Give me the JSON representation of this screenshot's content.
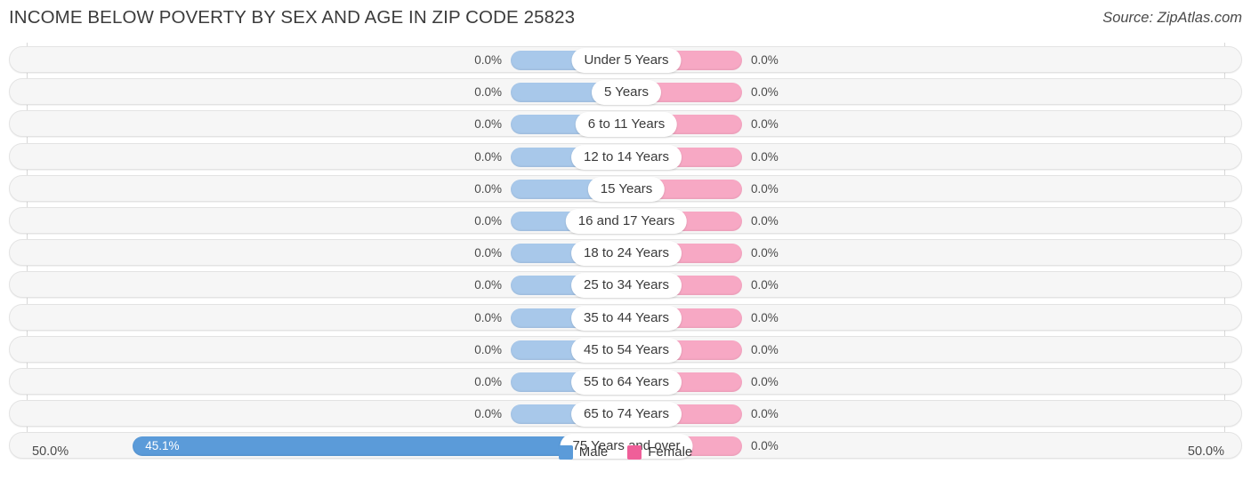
{
  "header": {
    "title": "INCOME BELOW POVERTY BY SEX AND AGE IN ZIP CODE 25823",
    "source": "Source: ZipAtlas.com"
  },
  "axis": {
    "left_label": "50.0%",
    "right_label": "50.0%"
  },
  "legend": {
    "male_label": "Male",
    "female_label": "Female",
    "male_color": "#5b9bd9",
    "female_color": "#ef5f99"
  },
  "colors": {
    "male_bar": "#a8c8ea",
    "male_bar_highlight": "#5b9bd9",
    "female_bar": "#f7a8c4",
    "row_track": "#f6f6f6",
    "gridline": "#d8d8d8"
  },
  "chart_data": {
    "type": "bar",
    "subtype": "diverging-bar",
    "title": "INCOME BELOW POVERTY BY SEX AND AGE IN ZIP CODE 25823",
    "xlabel": "",
    "ylabel": "",
    "xlim": [
      50.0,
      50.0
    ],
    "grid": true,
    "legend_position": "bottom-center",
    "categories": [
      "Under 5 Years",
      "5 Years",
      "6 to 11 Years",
      "12 to 14 Years",
      "15 Years",
      "16 and 17 Years",
      "18 to 24 Years",
      "25 to 34 Years",
      "35 to 44 Years",
      "45 to 54 Years",
      "55 to 64 Years",
      "65 to 74 Years",
      "75 Years and over"
    ],
    "series": [
      {
        "name": "Male",
        "side": "left",
        "values": [
          0.0,
          0.0,
          0.0,
          0.0,
          0.0,
          0.0,
          0.0,
          0.0,
          0.0,
          0.0,
          0.0,
          0.0,
          45.1
        ],
        "labels": [
          "0.0%",
          "0.0%",
          "0.0%",
          "0.0%",
          "0.0%",
          "0.0%",
          "0.0%",
          "0.0%",
          "0.0%",
          "0.0%",
          "0.0%",
          "0.0%",
          "45.1%"
        ]
      },
      {
        "name": "Female",
        "side": "right",
        "values": [
          0.0,
          0.0,
          0.0,
          0.0,
          0.0,
          0.0,
          0.0,
          0.0,
          0.0,
          0.0,
          0.0,
          0.0,
          0.0
        ],
        "labels": [
          "0.0%",
          "0.0%",
          "0.0%",
          "0.0%",
          "0.0%",
          "0.0%",
          "0.0%",
          "0.0%",
          "0.0%",
          "0.0%",
          "0.0%",
          "0.0%",
          "0.0%"
        ]
      }
    ]
  }
}
